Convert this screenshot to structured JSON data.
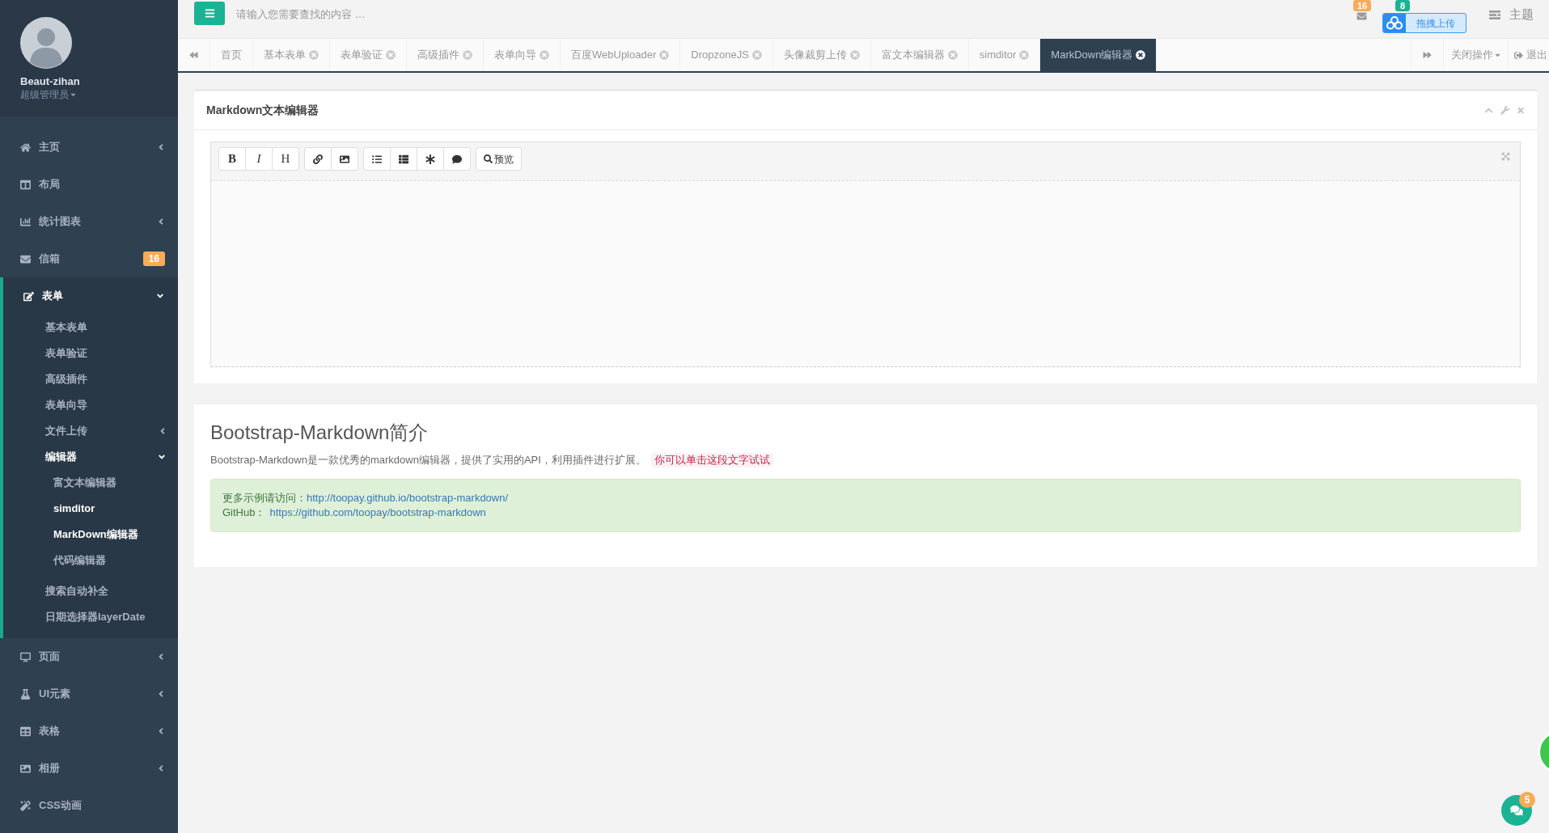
{
  "sidebar": {
    "profile": {
      "name": "Beaut-zihan",
      "role": "超级管理员"
    },
    "menu": [
      {
        "label": "主页",
        "selected": false,
        "expanded": false
      },
      {
        "label": "布局",
        "selected": false
      },
      {
        "label": "统计图表",
        "selected": false,
        "expanded": false
      },
      {
        "label": "信箱",
        "selected": false,
        "badge": "16"
      },
      {
        "label": "表单",
        "selected": true,
        "expanded": true,
        "children": [
          {
            "label": "基本表单",
            "selected": false
          },
          {
            "label": "表单验证",
            "selected": false
          },
          {
            "label": "高级插件",
            "selected": false
          },
          {
            "label": "表单向导",
            "selected": false
          },
          {
            "label": "文件上传",
            "selected": false,
            "expanded": false
          },
          {
            "label": "编辑器",
            "selected": true,
            "expanded": true,
            "children": [
              {
                "label": "富文本编辑器",
                "selected": false
              },
              {
                "label": "simditor",
                "selected": true
              },
              {
                "label": "MarkDown编辑器",
                "selected": true
              },
              {
                "label": "代码编辑器",
                "selected": false
              }
            ]
          },
          {
            "label": "搜索自动补全",
            "selected": false
          },
          {
            "label": "日期选择器layerDate",
            "selected": false
          }
        ]
      },
      {
        "label": "页面",
        "selected": false,
        "expanded": false
      },
      {
        "label": "UI元素",
        "selected": false,
        "expanded": false
      },
      {
        "label": "表格",
        "selected": false,
        "expanded": false
      },
      {
        "label": "相册",
        "selected": false,
        "expanded": false
      },
      {
        "label": "CSS动画",
        "selected": false
      }
    ]
  },
  "topbar": {
    "search": {
      "placeholder": "请输入您需要查找的内容 …"
    },
    "notifications": [
      {
        "badge": "16",
        "color": "#f8ac59"
      },
      {
        "badge": "8",
        "color": "#1ab394"
      }
    ],
    "links": [
      "主题"
    ],
    "upload_widget": {
      "label": "拖拽上传"
    }
  },
  "tabs": [
    {
      "label": "首页",
      "closable": false,
      "selected": false
    },
    {
      "label": "基本表单",
      "closable": true,
      "selected": false
    },
    {
      "label": "表单验证",
      "closable": true,
      "selected": false
    },
    {
      "label": "高级插件",
      "closable": true,
      "selected": false
    },
    {
      "label": "表单向导",
      "closable": true,
      "selected": false
    },
    {
      "label": "百度WebUploader",
      "closable": true,
      "selected": false
    },
    {
      "label": "DropzoneJS",
      "closable": true,
      "selected": false
    },
    {
      "label": "头像裁剪上传",
      "closable": true,
      "selected": false
    },
    {
      "label": "富文本编辑器",
      "closable": true,
      "selected": false
    },
    {
      "label": "simditor",
      "closable": true,
      "selected": false
    },
    {
      "label": "MarkDown编辑器",
      "closable": true,
      "selected": true
    }
  ],
  "tab_actions": {
    "close_menu": "关闭操作",
    "logout": "退出"
  },
  "editor_panel": {
    "title": "Markdown文本编辑器",
    "toolbar": {
      "letters": [
        "B",
        "I",
        "H"
      ],
      "preview": "预览"
    }
  },
  "intro_panel": {
    "heading": "Bootstrap-Markdown简介",
    "text": "Bootstrap-Markdown是一款优秀的markdown编辑器，提供了实用的API，利用插件进行扩展。",
    "tag": "你可以单击这段文字试试",
    "alert": [
      {
        "label": "更多示例请访问：",
        "link": "http://toopay.github.io/bootstrap-markdown/"
      },
      {
        "label": "GitHub：",
        "link": "https://github.com/toopay/bootstrap-markdown"
      }
    ]
  },
  "chat": {
    "badge": "5"
  }
}
